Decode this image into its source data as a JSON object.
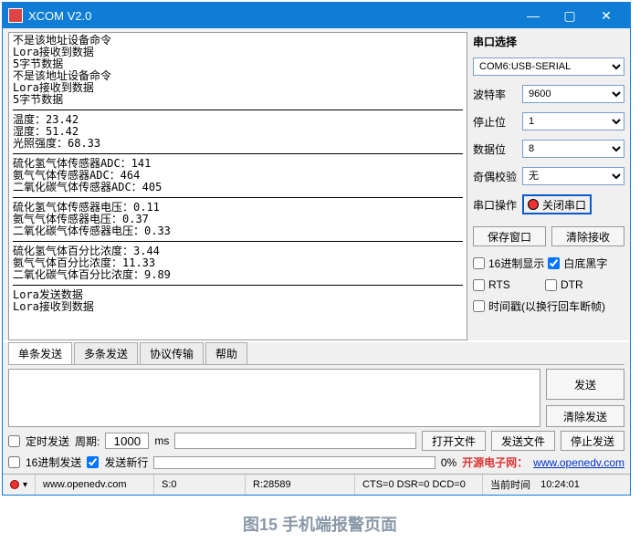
{
  "title": "XCOM V2.0",
  "output_lines": [
    "不是该地址设备命令",
    "Lora接收到数据",
    "5字节数据",
    "不是该地址设备命令",
    "Lora接收到数据",
    "5字节数据",
    "__HR__",
    "温度：23.42",
    "湿度：51.42",
    "光照强度：68.33",
    "__HR__",
    "硫化氢气体传感器ADC：141",
    "氨气气体传感器ADC：464",
    "二氧化碳气体传感器ADC：405",
    "__HR__",
    "硫化氢气体传感器电压：0.11",
    "氨气气体传感器电压：0.37",
    "二氧化碳气体传感器电压：0.33",
    "__HR__",
    "硫化氢气体百分比浓度：3.44",
    "氨气气体百分比浓度：11.33",
    "二氧化碳气体百分比浓度：9.89",
    "__HR__",
    "Lora发送数据",
    "Lora接收到数据"
  ],
  "right": {
    "section": "串口选择",
    "port": "COM6:USB-SERIAL",
    "baud_label": "波特率",
    "baud": "9600",
    "stop_label": "停止位",
    "stop": "1",
    "data_label": "数据位",
    "data": "8",
    "parity_label": "奇偶校验",
    "parity": "无",
    "op_label": "串口操作",
    "op_btn": "关闭串口",
    "save_window": "保存窗口",
    "clear_recv": "清除接收",
    "hex_disp": "16进制显示",
    "white_bg": "白底黑字",
    "rts": "RTS",
    "dtr": "DTR",
    "timestamp": "时间戳(以换行回车断帧)"
  },
  "tabs": [
    "单条发送",
    "多条发送",
    "协议传输",
    "帮助"
  ],
  "send": {
    "send_btn": "发送",
    "clear_send": "清除发送"
  },
  "opt": {
    "timed_send": "定时发送",
    "period_label": "周期:",
    "period": "1000",
    "ms": "ms",
    "open_file": "打开文件",
    "send_file": "发送文件",
    "stop_send": "停止发送",
    "hex_send": "16进制发送",
    "send_newline": "发送新行",
    "progress": "0%",
    "link_label": "开源电子网：",
    "link_url": "www.openedv.com"
  },
  "status": {
    "url": "www.openedv.com",
    "s": "S:0",
    "r": "R:28589",
    "cts": "CTS=0 DSR=0 DCD=0",
    "time_label": "当前时间",
    "time": "10:24:01"
  },
  "caption": "图15 手机端报警页面"
}
